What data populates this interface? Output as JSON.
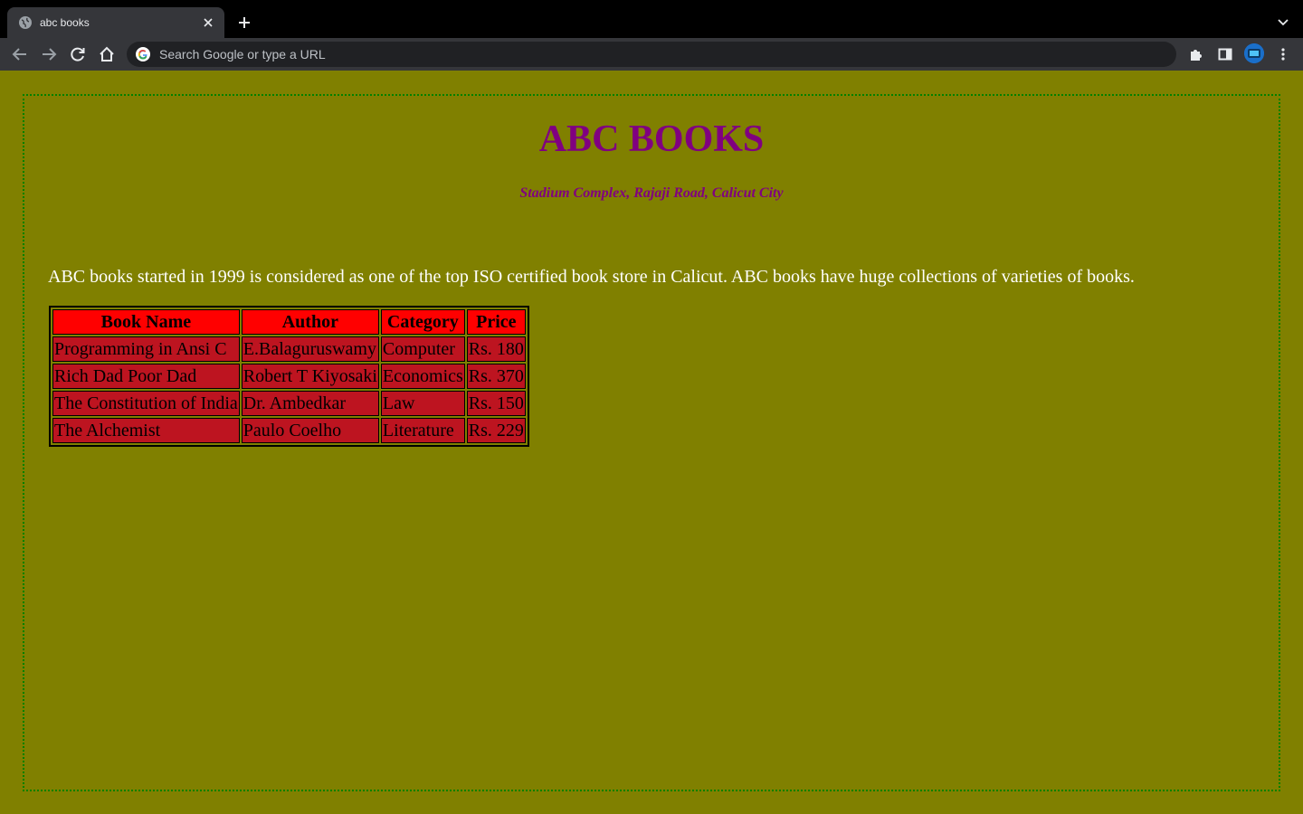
{
  "browser": {
    "tab_title": "abc books",
    "omnibox_placeholder": "Search Google or type a URL"
  },
  "page": {
    "title": "ABC BOOKS",
    "address": "Stadium Complex, Rajaji Road, Calicut City",
    "intro": "ABC books started in 1999 is considered as one of the top ISO certified book store in Calicut. ABC books have huge collections of varieties of books.",
    "table": {
      "headers": [
        "Book Name",
        "Author",
        "Category",
        "Price"
      ],
      "rows": [
        [
          "Programming in Ansi C",
          "E.Balaguruswamy",
          "Computer",
          "Rs. 180"
        ],
        [
          "Rich Dad Poor Dad",
          "Robert T Kiyosaki",
          "Economics",
          "Rs. 370"
        ],
        [
          "The Constitution of India",
          "Dr. Ambedkar",
          "Law",
          "Rs. 150"
        ],
        [
          "The Alchemist",
          "Paulo Coelho",
          "Literature",
          "Rs. 229"
        ]
      ]
    }
  },
  "colors": {
    "page_background": "#808000",
    "heading": "#800080",
    "table_header": "#ff0000",
    "table_cell": "#bd1420",
    "frame_border": "#008000"
  }
}
